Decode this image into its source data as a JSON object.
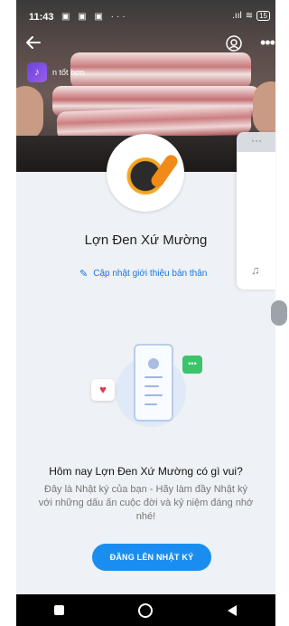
{
  "statusbar": {
    "time": "11:43",
    "notification_icons": "▣ ▣ ▣ ···",
    "signal": ".ııl",
    "wifi": "≋",
    "battery": "15"
  },
  "header": {
    "music_text": "n tốt hơn"
  },
  "profile": {
    "name": "Lợn Đen Xứ Mường",
    "update_link": "Cập nhật giới thiệu bản thân"
  },
  "side_panel": {
    "top_dots": "···",
    "note_icon": "♫"
  },
  "empty_state": {
    "headline": "Hôm nay Lợn Đen Xứ Mường có gì vui?",
    "description": "Đây là Nhật ký của bạn - Hãy làm đầy Nhật ký với những dấu ấn cuộc đời và kỷ niệm đáng nhớ nhé!",
    "cta_label": "ĐĂNG LÊN NHẬT KÝ"
  },
  "icons": {
    "back": "arrow-left-icon",
    "eye": "eye-icon",
    "more": "more-icon",
    "heart": "heart-icon",
    "chat": "chat-icon"
  },
  "colors": {
    "accent": "#1a8ef0",
    "link": "#1a73e8",
    "chat_green": "#3cc46b",
    "heart_red": "#e0364b"
  }
}
